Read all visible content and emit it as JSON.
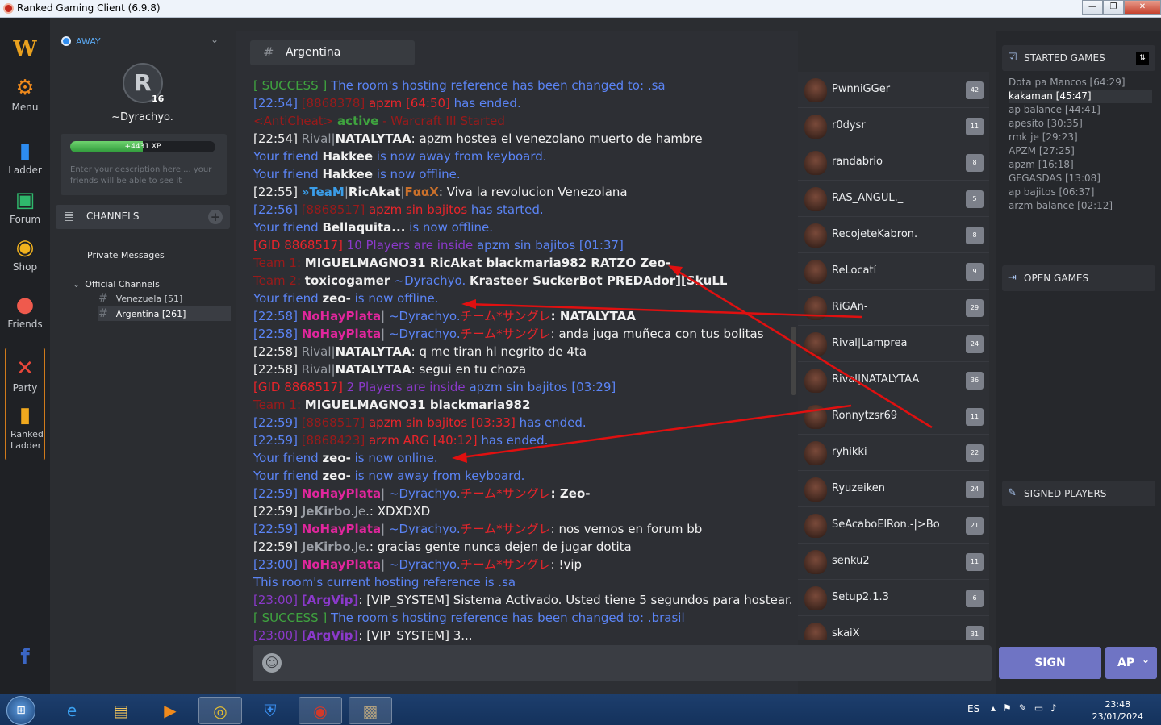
{
  "window": {
    "title": "Ranked Gaming Client (6.9.8)",
    "min": "—",
    "max": "❐",
    "close": "✕"
  },
  "nav": {
    "logo": "W",
    "items": [
      {
        "label": "Menu",
        "icon": "gear-icon",
        "glyph": "⚙"
      },
      {
        "label": "Ladder",
        "icon": "bar-chart-icon",
        "glyph": "▮"
      },
      {
        "label": "Forum",
        "icon": "forum-icon",
        "glyph": "▣"
      },
      {
        "label": "Shop",
        "icon": "coins-icon",
        "glyph": "◉"
      },
      {
        "label": "Friends",
        "icon": "friends-icon",
        "glyph": "●"
      },
      {
        "label": "Party",
        "icon": "swords-icon",
        "glyph": "✕"
      },
      {
        "label": "Ranked Ladder",
        "icon": "ranked-ladder-icon",
        "glyph": "▮"
      }
    ],
    "facebook": "f"
  },
  "profile": {
    "status": "AWAY",
    "avatar_glyph": "R",
    "level": "16",
    "username": "~Dyrachyo.",
    "xp_text": "+4431 XP",
    "xp_progress": 0.5,
    "description_placeholder": "Enter your description here ... your friends will be able to see it"
  },
  "channels": {
    "header": "CHANNELS",
    "plus": "+",
    "private_messages": "Private Messages",
    "official_group": "Official Channels",
    "official_chevron": "⌄",
    "hash": "#",
    "items": [
      {
        "label": "Venezuela [51]"
      },
      {
        "label": "Argentina [261]"
      }
    ]
  },
  "chat": {
    "hash": "#",
    "channel_name": "Argentina",
    "emoji": "☺",
    "messages": [
      [
        {
          "t": "[ SUCCESS ] ",
          "c": "c-green"
        },
        {
          "t": "The room's hosting reference has been changed to: ",
          "c": "c-blue"
        },
        {
          "t": ".sa",
          "c": "c-blue"
        }
      ],
      [
        {
          "t": "[22:54] ",
          "c": "c-blue"
        },
        {
          "t": "[8868378] ",
          "c": "c-dred"
        },
        {
          "t": "apzm [64:50]",
          "c": "c-red"
        },
        {
          "t": " has ended.",
          "c": "c-blue"
        }
      ],
      [
        {
          "t": "<AntiCheat> ",
          "c": "c-dred"
        },
        {
          "t": "active",
          "c": "c-green b"
        },
        {
          "t": " - Warcraft III Started",
          "c": "c-dred"
        }
      ],
      [
        {
          "t": "[22:54] ",
          "c": "c-white"
        },
        {
          "t": "Rival",
          "c": "c-gray"
        },
        {
          "t": "|",
          "c": "c-gray"
        },
        {
          "t": "NATALYTAA",
          "c": "c-white b"
        },
        {
          "t": ": apzm hostea el venezolano muerto de hambre",
          "c": "c-white"
        }
      ],
      [
        {
          "t": "Your friend ",
          "c": "c-blue"
        },
        {
          "t": "Hakkee",
          "c": "c-white b"
        },
        {
          "t": " is now away from keyboard.",
          "c": "c-blue"
        }
      ],
      [
        {
          "t": "Your friend ",
          "c": "c-blue"
        },
        {
          "t": "Hakkee",
          "c": "c-white b"
        },
        {
          "t": " is now offline.",
          "c": "c-blue"
        }
      ],
      [
        {
          "t": "[22:55] ",
          "c": "c-white"
        },
        {
          "t": "»TeaM",
          "c": "c-lb b"
        },
        {
          "t": "|",
          "c": "c-gray"
        },
        {
          "t": "RicAkat",
          "c": "c-white b"
        },
        {
          "t": "|",
          "c": "c-gray"
        },
        {
          "t": "FααX",
          "c": "c-orange b"
        },
        {
          "t": ": Viva la revolucion Venezolana",
          "c": "c-white"
        }
      ],
      [
        {
          "t": "[22:56] ",
          "c": "c-blue"
        },
        {
          "t": "[8868517] ",
          "c": "c-dred"
        },
        {
          "t": "apzm sin bajitos",
          "c": "c-red"
        },
        {
          "t": " has started.",
          "c": "c-blue"
        }
      ],
      [
        {
          "t": "Your friend ",
          "c": "c-blue"
        },
        {
          "t": "Bellaquita...",
          "c": "c-white b"
        },
        {
          "t": " is now offline.",
          "c": "c-blue"
        }
      ],
      [
        {
          "t": "[GID 8868517] ",
          "c": "c-red"
        },
        {
          "t": "10 Players are inside ",
          "c": "c-purple"
        },
        {
          "t": "apzm sin bajitos [01:37]",
          "c": "c-blue"
        }
      ],
      [
        {
          "t": "Team 1:  ",
          "c": "c-dred"
        },
        {
          "t": "MIGUELMAGNO31   RicAkat   blackmaria982   RATZO   Zeo-",
          "c": "c-white b"
        }
      ],
      [
        {
          "t": "Team 2:  ",
          "c": "c-dred"
        },
        {
          "t": "toxicogamer   ",
          "c": "c-white b"
        },
        {
          "t": "~Dyrachyo.   ",
          "c": "c-blue"
        },
        {
          "t": "Krasteer   SuckerBot   PREDAdor][SkuLL",
          "c": "c-white b"
        }
      ],
      [
        {
          "t": "Your friend ",
          "c": "c-blue"
        },
        {
          "t": "zeo-",
          "c": "c-white b"
        },
        {
          "t": " is now offline.",
          "c": "c-blue"
        }
      ],
      [
        {
          "t": "[22:58] ",
          "c": "c-blue"
        },
        {
          "t": "NoHayPlata",
          "c": "c-pink b"
        },
        {
          "t": "| ",
          "c": "c-gray"
        },
        {
          "t": "~Dyrachyo.",
          "c": "c-blue"
        },
        {
          "t": "チーム*サングレ",
          "c": "c-red"
        },
        {
          "t": ":  NATALYTAA",
          "c": "c-white b"
        }
      ],
      [
        {
          "t": "[22:58] ",
          "c": "c-blue"
        },
        {
          "t": "NoHayPlata",
          "c": "c-pink b"
        },
        {
          "t": "| ",
          "c": "c-gray"
        },
        {
          "t": "~Dyrachyo.",
          "c": "c-blue"
        },
        {
          "t": "チーム*サングレ",
          "c": "c-red"
        },
        {
          "t": ":  anda juga muñeca con tus bolitas",
          "c": "c-white"
        }
      ],
      [
        {
          "t": "[22:58] ",
          "c": "c-white"
        },
        {
          "t": "Rival",
          "c": "c-gray"
        },
        {
          "t": "|",
          "c": "c-gray"
        },
        {
          "t": "NATALYTAA",
          "c": "c-white b"
        },
        {
          "t": ": q me tiran hl negrito de 4ta",
          "c": "c-white"
        }
      ],
      [
        {
          "t": "[22:58] ",
          "c": "c-white"
        },
        {
          "t": "Rival",
          "c": "c-gray"
        },
        {
          "t": "|",
          "c": "c-gray"
        },
        {
          "t": "NATALYTAA",
          "c": "c-white b"
        },
        {
          "t": ": segui en tu choza",
          "c": "c-white"
        }
      ],
      [
        {
          "t": "[GID 8868517] ",
          "c": "c-red"
        },
        {
          "t": "2 Players are inside ",
          "c": "c-purple"
        },
        {
          "t": "apzm sin bajitos [03:29]",
          "c": "c-blue"
        }
      ],
      [
        {
          "t": "Team 1:  ",
          "c": "c-dred"
        },
        {
          "t": "MIGUELMAGNO31   blackmaria982",
          "c": "c-white b"
        }
      ],
      [
        {
          "t": "[22:59] ",
          "c": "c-blue"
        },
        {
          "t": "[8868517] ",
          "c": "c-dred"
        },
        {
          "t": "apzm sin bajitos [03:33]",
          "c": "c-red"
        },
        {
          "t": " has ended.",
          "c": "c-blue"
        }
      ],
      [
        {
          "t": "[22:59] ",
          "c": "c-blue"
        },
        {
          "t": "[8868423] ",
          "c": "c-dred"
        },
        {
          "t": "arzm ARG [40:12]",
          "c": "c-red"
        },
        {
          "t": " has ended.",
          "c": "c-blue"
        }
      ],
      [
        {
          "t": "Your friend ",
          "c": "c-blue"
        },
        {
          "t": "zeo-",
          "c": "c-white b"
        },
        {
          "t": " is now online.",
          "c": "c-blue"
        }
      ],
      [
        {
          "t": "Your friend ",
          "c": "c-blue"
        },
        {
          "t": "zeo-",
          "c": "c-white b"
        },
        {
          "t": " is now away from keyboard.",
          "c": "c-blue"
        }
      ],
      [
        {
          "t": "[22:59] ",
          "c": "c-blue"
        },
        {
          "t": "NoHayPlata",
          "c": "c-pink b"
        },
        {
          "t": "| ",
          "c": "c-gray"
        },
        {
          "t": "~Dyrachyo.",
          "c": "c-blue"
        },
        {
          "t": "チーム*サングレ",
          "c": "c-red"
        },
        {
          "t": ":  Zeo-",
          "c": "c-white b"
        }
      ],
      [
        {
          "t": "[22:59] ",
          "c": "c-white"
        },
        {
          "t": "JeKirbo",
          "c": "c-gray b"
        },
        {
          "t": ".",
          "c": "c-white"
        },
        {
          "t": "Je",
          "c": "c-gray"
        },
        {
          "t": ".: XDXDXD",
          "c": "c-white"
        }
      ],
      [
        {
          "t": "[22:59] ",
          "c": "c-blue"
        },
        {
          "t": "NoHayPlata",
          "c": "c-pink b"
        },
        {
          "t": "| ",
          "c": "c-gray"
        },
        {
          "t": "~Dyrachyo.",
          "c": "c-blue"
        },
        {
          "t": "チーム*サングレ",
          "c": "c-red"
        },
        {
          "t": ":  nos vemos en forum bb",
          "c": "c-white"
        }
      ],
      [
        {
          "t": "[22:59] ",
          "c": "c-white"
        },
        {
          "t": "JeKirbo",
          "c": "c-gray b"
        },
        {
          "t": ".",
          "c": "c-white"
        },
        {
          "t": "Je",
          "c": "c-gray"
        },
        {
          "t": ".: gracias gente nunca dejen de jugar dotita",
          "c": "c-white"
        }
      ],
      [
        {
          "t": "[23:00] ",
          "c": "c-blue"
        },
        {
          "t": "NoHayPlata",
          "c": "c-pink b"
        },
        {
          "t": "| ",
          "c": "c-gray"
        },
        {
          "t": "~Dyrachyo.",
          "c": "c-blue"
        },
        {
          "t": "チーム*サングレ",
          "c": "c-red"
        },
        {
          "t": ":  !vip",
          "c": "c-white"
        }
      ],
      [
        {
          "t": "This room's current hosting reference is ",
          "c": "c-blue"
        },
        {
          "t": ".sa",
          "c": "c-blue"
        }
      ],
      [
        {
          "t": "[23:00] ",
          "c": "c-purple"
        },
        {
          "t": "[ArgVip]",
          "c": "c-purple b"
        },
        {
          "t": ": [VIP_SYSTEM] Sistema Activado. Usted tiene 5 segundos para hostear...",
          "c": "c-white"
        }
      ],
      [
        {
          "t": "[ SUCCESS ] ",
          "c": "c-green"
        },
        {
          "t": "The room's hosting reference has been changed to: ",
          "c": "c-blue"
        },
        {
          "t": ".brasil",
          "c": "c-blue"
        }
      ],
      [
        {
          "t": "[23:00] ",
          "c": "c-purple"
        },
        {
          "t": "[ArgVip]",
          "c": "c-purple b"
        },
        {
          "t": ": [VIP_SYSTEM] 3...",
          "c": "c-white"
        }
      ]
    ]
  },
  "players": [
    {
      "name": "PwnniGGer",
      "badge": "42"
    },
    {
      "name": "r0dysr",
      "badge": "11"
    },
    {
      "name": "randabrio",
      "badge": "8"
    },
    {
      "name": "RAS_ANGUL._",
      "badge": "5"
    },
    {
      "name": "RecojeteKabron.",
      "badge": "8"
    },
    {
      "name": "ReLocatí",
      "badge": "9"
    },
    {
      "name": "RiGAn-",
      "badge": "29"
    },
    {
      "name": "Rival|Lamprea",
      "badge": "24"
    },
    {
      "name": "Rival|NATALYTAA",
      "badge": "36"
    },
    {
      "name": "Ronnytzsr69",
      "badge": "11"
    },
    {
      "name": "ryhikki",
      "badge": "22"
    },
    {
      "name": "Ryuzeiken",
      "badge": "24"
    },
    {
      "name": "SeAcaboElRon.-|>Bo",
      "badge": "21"
    },
    {
      "name": "senku2",
      "badge": "11"
    },
    {
      "name": "Setup2.1.3",
      "badge": "6"
    },
    {
      "name": "skaiX",
      "badge": "31"
    }
  ],
  "right": {
    "started_header": "STARTED GAMES",
    "open_header": "OPEN GAMES",
    "signed_header": "SIGNED PLAYERS",
    "games": [
      "Dota pa Mancos [64:29]",
      "kakaman [45:47]",
      "ap balance [44:41]",
      "apesito [30:35]",
      "rmk je [29:23]",
      "APZM [27:25]",
      "apzm [16:18]",
      "GFGASDAS [13:08]",
      "ap bajitos [06:37]",
      "arzm balance [02:12]"
    ],
    "sign_label": "SIGN",
    "ap_label": "AP",
    "ap_chevron": "⌄"
  },
  "taskbar": {
    "lang": "ES",
    "time": "23:48",
    "date": "23/01/2024"
  },
  "colors": {
    "arrow": "#e01010",
    "accent": "#6f74c4",
    "background": "#2b2d31"
  }
}
